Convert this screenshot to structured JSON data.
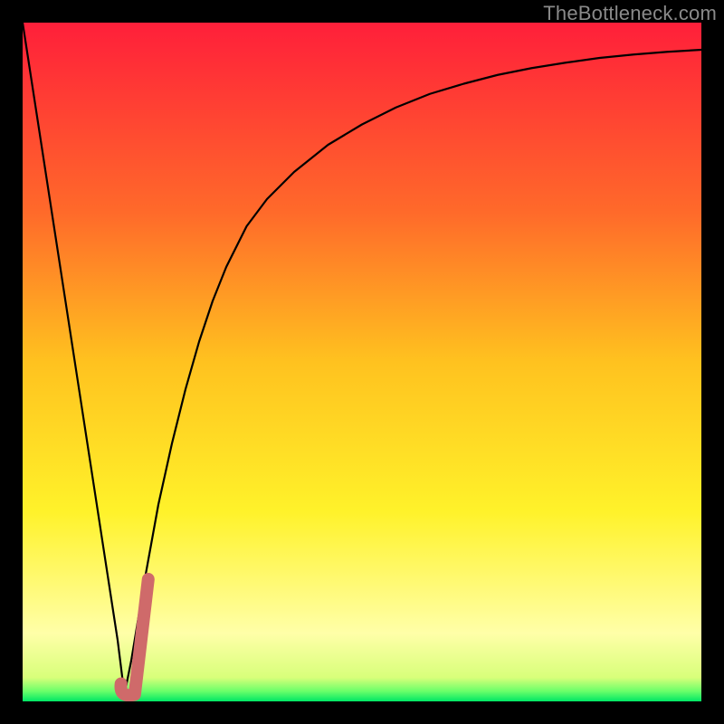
{
  "watermark": "TheBottleneck.com",
  "colors": {
    "top": "#ff1f3a",
    "mid_upper": "#ff8a2a",
    "mid": "#ffd21f",
    "mid_lower": "#fff22a",
    "pale_yellow": "#ffffa8",
    "green": "#00e765",
    "curve": "#000000",
    "mark": "#cf6a6a",
    "frame": "#000000"
  },
  "chart_data": {
    "type": "line",
    "title": "",
    "xlabel": "",
    "ylabel": "",
    "xlim": [
      0,
      100
    ],
    "ylim": [
      0,
      100
    ],
    "series": [
      {
        "name": "bottleneck-curve",
        "x": [
          0,
          2,
          4,
          6,
          8,
          10,
          12,
          14,
          15,
          16,
          18,
          20,
          22,
          24,
          26,
          28,
          30,
          33,
          36,
          40,
          45,
          50,
          55,
          60,
          65,
          70,
          75,
          80,
          85,
          90,
          95,
          100
        ],
        "y": [
          100,
          87,
          74,
          61,
          48,
          35,
          22,
          9,
          1,
          6,
          18,
          29,
          38,
          46,
          53,
          59,
          64,
          70,
          74,
          78,
          82,
          85,
          87.5,
          89.5,
          91,
          92.3,
          93.3,
          94.1,
          94.8,
          95.3,
          95.7,
          96
        ]
      }
    ],
    "marker": {
      "name": "highlight-j",
      "x_range": [
        14.5,
        18.5
      ],
      "y_range": [
        1,
        18
      ],
      "color": "#cf6a6a"
    },
    "gradient_stops": [
      {
        "pos": 0.0,
        "color": "#ff1f3a"
      },
      {
        "pos": 0.28,
        "color": "#ff6a2a"
      },
      {
        "pos": 0.5,
        "color": "#ffc21f"
      },
      {
        "pos": 0.72,
        "color": "#fff22a"
      },
      {
        "pos": 0.9,
        "color": "#ffffa8"
      },
      {
        "pos": 0.965,
        "color": "#d8ff7a"
      },
      {
        "pos": 0.985,
        "color": "#6aff6a"
      },
      {
        "pos": 1.0,
        "color": "#00e765"
      }
    ]
  }
}
